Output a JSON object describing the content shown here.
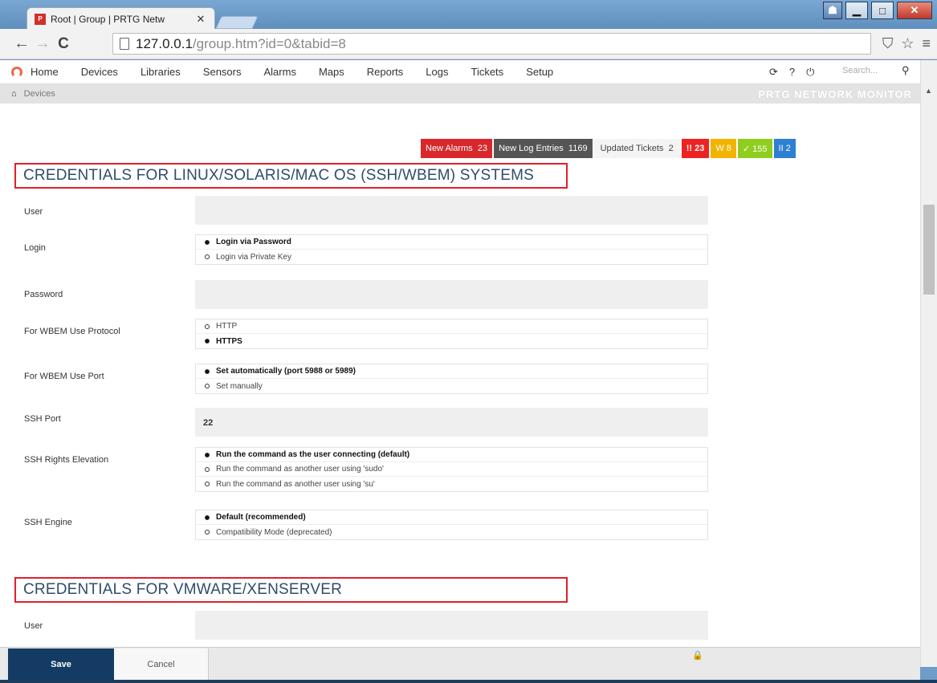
{
  "browser": {
    "tab_title": "Root | Group | PRTG Netw",
    "tab_close": "✕",
    "favicon_text": "P",
    "url_host": "127.0.0.1",
    "url_path": "/group.htm?id=0&tabid=8",
    "back": "←",
    "forward": "→",
    "reload": "C",
    "minimize": "▁",
    "maximize": "□",
    "close": "✕",
    "user": "☗",
    "ext_icon": "⛉",
    "star": "☆",
    "menu": "≡"
  },
  "app_nav": {
    "items": [
      "Home",
      "Devices",
      "Libraries",
      "Sensors",
      "Alarms",
      "Maps",
      "Reports",
      "Logs",
      "Tickets",
      "Setup"
    ],
    "search_placeholder": "Search...",
    "refresh_icon": "⟳",
    "help_icon": "?",
    "logout_icon": "⏻",
    "search_icon": "⚲"
  },
  "breadcrumb": {
    "home_icon": "⌂",
    "current": "Devices",
    "brand": "PRTG NETWORK MONITOR"
  },
  "status_bar": {
    "new_alarms_label": "New Alarms",
    "new_alarms_count": "23",
    "new_log_label": "New Log Entries",
    "new_log_count": "1169",
    "updated_tickets_label": "Updated Tickets",
    "updated_tickets_count": "2",
    "down": "!! 23",
    "warning": "W 8",
    "up": "✓ 155",
    "paused": "II 2"
  },
  "sections": {
    "linux": {
      "title": "CREDENTIALS FOR LINUX/SOLARIS/MAC OS (SSH/WBEM) SYSTEMS",
      "user_label": "User",
      "user_value": "",
      "login_label": "Login",
      "login_options": [
        "Login via Password",
        "Login via Private Key"
      ],
      "password_label": "Password",
      "password_value": "",
      "wbem_protocol_label": "For WBEM Use Protocol",
      "wbem_protocol_options": [
        "HTTP",
        "HTTPS"
      ],
      "wbem_port_label": "For WBEM Use Port",
      "wbem_port_options": [
        "Set automatically (port 5988 or 5989)",
        "Set manually"
      ],
      "ssh_port_label": "SSH Port",
      "ssh_port_value": "22",
      "ssh_rights_label": "SSH Rights Elevation",
      "ssh_rights_options": [
        "Run the command as the user connecting (default)",
        "Run the command as another user using 'sudo'",
        "Run the command as another user using 'su'"
      ],
      "ssh_engine_label": "SSH Engine",
      "ssh_engine_options": [
        "Default (recommended)",
        "Compatibility Mode (deprecated)"
      ]
    },
    "vmware": {
      "title": "CREDENTIALS FOR VMWARE/XENSERVER",
      "user_label": "User",
      "user_value": ""
    }
  },
  "footer": {
    "save_label": "Save",
    "cancel_label": "Cancel",
    "lock_icon": "🔒"
  }
}
